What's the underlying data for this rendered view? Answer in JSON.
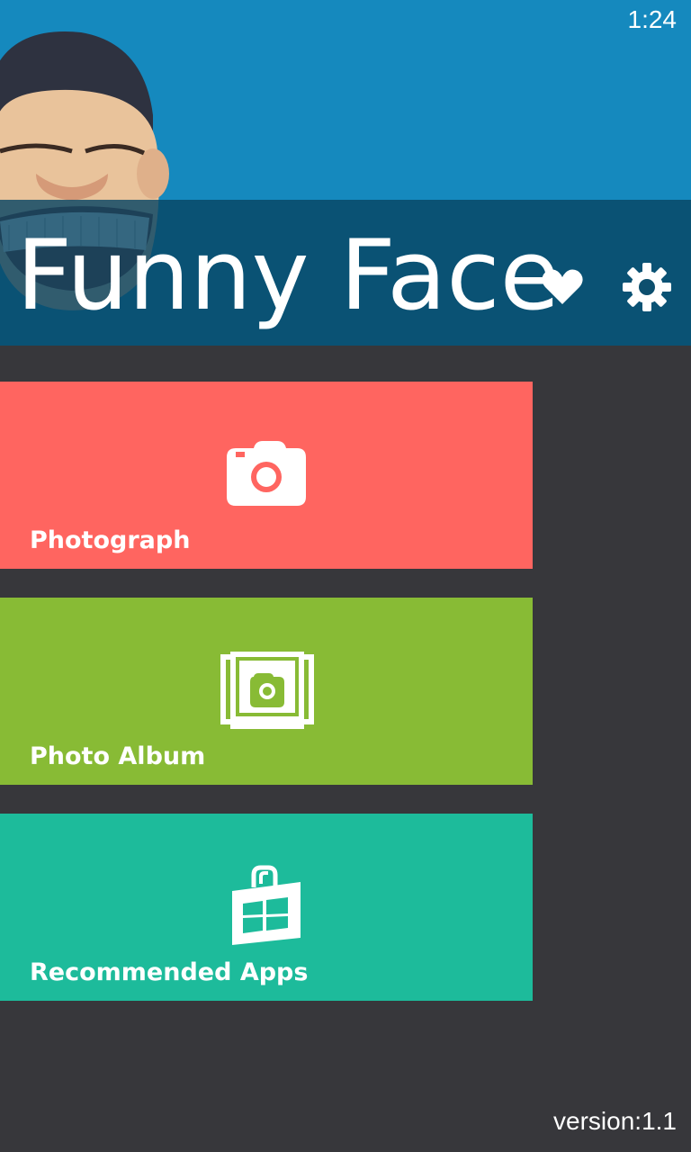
{
  "status_bar": {
    "time": "1:24"
  },
  "header": {
    "app_title": "Funny Face",
    "favorite_icon": "heart-icon",
    "settings_icon": "gear-icon",
    "background_color": "#1589be"
  },
  "tiles": [
    {
      "label": "Photograph",
      "icon": "camera-icon",
      "color": "#ff6560"
    },
    {
      "label": "Photo Album",
      "icon": "photo-album-icon",
      "color": "#88bb35"
    },
    {
      "label": "Recommended Apps",
      "icon": "store-icon",
      "color": "#1dbb9b"
    }
  ],
  "footer": {
    "version": "version:1.1"
  }
}
